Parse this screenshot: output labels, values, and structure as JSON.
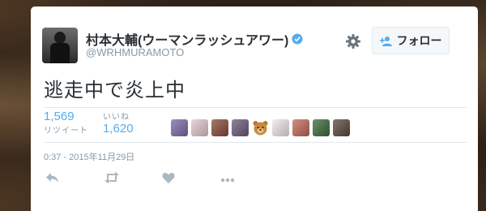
{
  "user": {
    "display_name": "村本大輔(ウーマンラッシュアワー)",
    "handle": "@WRHMURAMOTO",
    "verified": true
  },
  "follow_button": {
    "label": "フォロー",
    "icon": "add-person-icon"
  },
  "settings": {
    "icon": "gear-icon"
  },
  "tweet": {
    "text": "逃走中で炎上中",
    "timestamp": "0:37 - 2015年11月29日"
  },
  "stats": {
    "retweets": {
      "count": "1,569",
      "label": "リツイート"
    },
    "likes": {
      "count": "1,620",
      "label": "いいね"
    }
  },
  "liker_avatars": [
    {
      "icon": "liker-avatar-icon",
      "color": "#7c6aa8"
    },
    {
      "icon": "liker-avatar-icon",
      "color": "#e3c7cf"
    },
    {
      "icon": "liker-avatar-icon",
      "color": "#8a4a3a"
    },
    {
      "icon": "liker-avatar-icon",
      "color": "#6b5a7a"
    },
    {
      "icon": "bear-emoji-icon",
      "color": "#c98a3a"
    },
    {
      "icon": "liker-avatar-icon",
      "color": "#f2e6ec"
    },
    {
      "icon": "liker-avatar-icon",
      "color": "#c06a5a"
    },
    {
      "icon": "liker-avatar-icon",
      "color": "#3e6a3a"
    },
    {
      "icon": "liker-avatar-icon",
      "color": "#5a4a3a"
    }
  ],
  "actions": [
    "reply-icon",
    "retweet-icon",
    "like-icon",
    "more-icon"
  ],
  "colors": {
    "accent": "#55acee",
    "text": "#292f33",
    "muted": "#8899a6",
    "verified": "#55acee"
  }
}
